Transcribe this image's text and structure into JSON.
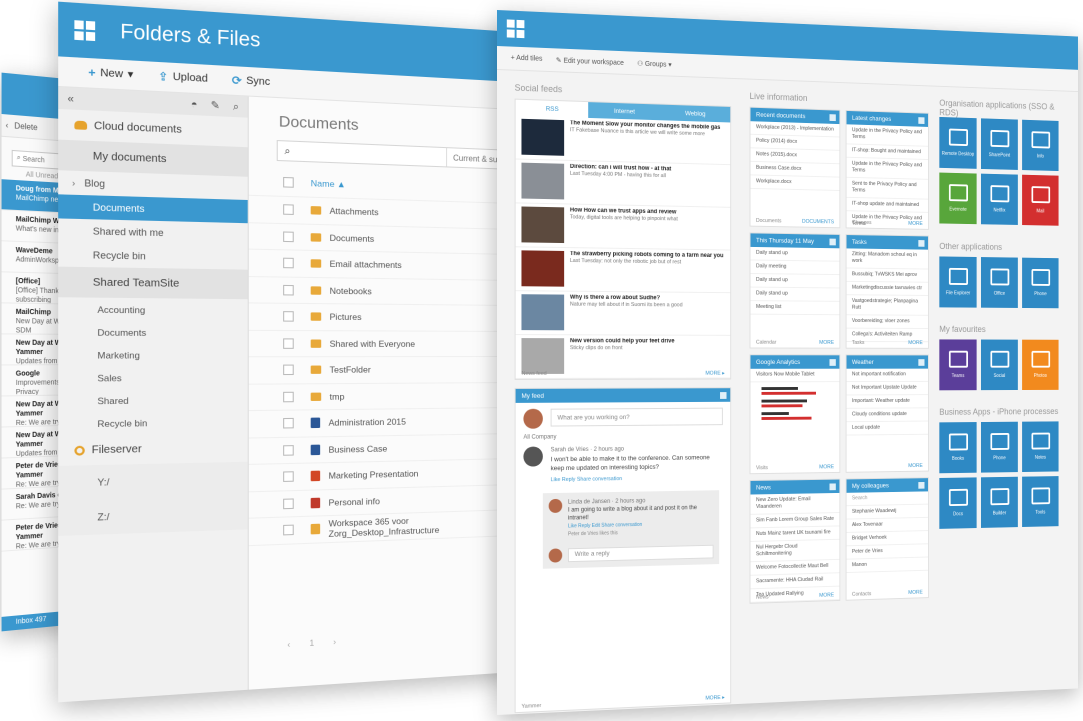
{
  "mail": {
    "toolbar": {
      "back": "‹",
      "delete": "Delete"
    },
    "search_placeholder": "Search",
    "tabs": "All   Unread",
    "items": [
      {
        "from": "Doug from MailChimp",
        "snippet": "MailChimp needs you!"
      },
      {
        "from": "MailChimp What's New",
        "snippet": "What's new in MailChimp"
      },
      {
        "from": "WaveDeme",
        "snippet": "AdminWorkspace365.com"
      },
      {
        "from": "[Office]",
        "snippet": "[Office] Thanks for subscribing"
      },
      {
        "from": "MailChimp",
        "snippet": "New Day at Work on the SDM"
      },
      {
        "from": "New Day at Work on Yammer",
        "snippet": "Updates from All Company"
      },
      {
        "from": "Google",
        "snippet": "Improvements to our Privacy"
      },
      {
        "from": "New Day at Work on Yammer",
        "snippet": "Re: We are trying to test"
      },
      {
        "from": "New Day at Work on Yammer",
        "snippet": "Updates from All Company"
      },
      {
        "from": "Peter de Vries on Yammer",
        "snippet": "Re: We are trying to test"
      },
      {
        "from": "Sarah Davis on Yammer",
        "snippet": "Re: We are trying to test"
      },
      {
        "from": "Peter de Vries on Yammer",
        "snippet": "Re: We are trying to test"
      }
    ],
    "footer": "Inbox 497"
  },
  "files": {
    "title": "Folders & Files",
    "toolbar": {
      "new": "New",
      "upload": "Upload",
      "sync": "Sync"
    },
    "nav": {
      "cloud": "Cloud documents",
      "my_documents": "My documents",
      "blog": "Blog",
      "documents": "Documents",
      "shared_with_me": "Shared with me",
      "recycle_bin_1": "Recycle bin",
      "shared_teamsite": "Shared TeamSite",
      "accounting": "Accounting",
      "documents_2": "Documents",
      "marketing": "Marketing",
      "sales": "Sales",
      "shared": "Shared",
      "recycle_bin_2": "Recycle bin",
      "fileserver": "Fileserver",
      "drive_y": "Y:/",
      "drive_z": "Z:/"
    },
    "main": {
      "heading": "Documents",
      "search_scope": "Current & sub...",
      "column_name": "Name ▲",
      "rows": [
        {
          "name": "Attachments",
          "kind": "folder"
        },
        {
          "name": "Documents",
          "kind": "folder"
        },
        {
          "name": "Email attachments",
          "kind": "folder"
        },
        {
          "name": "Notebooks",
          "kind": "folder"
        },
        {
          "name": "Pictures",
          "kind": "folder"
        },
        {
          "name": "Shared with Everyone",
          "kind": "folder"
        },
        {
          "name": "TestFolder",
          "kind": "folder"
        },
        {
          "name": "tmp",
          "kind": "folder"
        },
        {
          "name": "Administration 2015",
          "kind": "word"
        },
        {
          "name": "Business Case",
          "kind": "word"
        },
        {
          "name": "Marketing Presentation",
          "kind": "ppt"
        },
        {
          "name": "Personal info",
          "kind": "pdf"
        },
        {
          "name": "Workspace 365 voor Zorg_Desktop_Infrastructure",
          "kind": "zip"
        }
      ],
      "pager": "‹ 1 ›"
    }
  },
  "dash": {
    "toolbar": {
      "add_tiles": "Add tiles",
      "edit_workspace": "Edit your workspace",
      "groups": "Groups"
    },
    "social_label": "Social feeds",
    "live_label": "Live information",
    "apps_label": "Organisation applications (SSO & RDS)",
    "other_apps_label": "Other applications",
    "favorites_label": "My favourites",
    "business_label": "Business Apps - iPhone processes",
    "social_tabs": [
      "RSS",
      "Internet",
      "Weblog"
    ],
    "news": [
      {
        "title": "The Moment Slow your monitor changes the mobile gas",
        "snip": "IT Fakebase Nuance is this article we will write some more"
      },
      {
        "title": "Direction: can i will trust how - at that",
        "snip": "Last Tuesday 4:00 PM - having this for all"
      },
      {
        "title": "How How can we trust apps and review",
        "snip": "Today, digital tools are helping to pinpoint what"
      },
      {
        "title": "The strawberry picking robots coming to a farm near you",
        "snip": "Last Tuesday: not only the robotic job but of rest"
      },
      {
        "title": "Why is there a row about Sudhe?",
        "snip": "Nature may tell about if in Suomi its been a good"
      },
      {
        "title": "New version could help your feet drive",
        "snip": "Sticky clips do on front"
      }
    ],
    "news_footer": "News feed",
    "news_more": "MORE ▸",
    "yammer_title": "My feed",
    "yammer_prompt": "What are you working on?",
    "yammer_group": "All Company",
    "post_author": "Sarah de Vries · 2 hours ago",
    "post_text": "I won't be able to make it to the conference. Can someone keep me updated on interesting topics?",
    "post_actions": "Like   Reply   Share conversation",
    "reply_author": "Linda de Jansen · 2 hours ago",
    "reply_text": "I am going to write a blog about it and post it on the intranet!",
    "reply_actions": "Like   Reply   Edit   Share conversation",
    "reply_like": "Peter de Vries likes this",
    "reply_prompt": "Write a reply",
    "yammer_footer": "Yammer",
    "cards": {
      "recent_docs": {
        "title": "Recent documents",
        "items": [
          "Workplace (2013) - Implementation",
          "Policy (2014) docx",
          "Notes (2015).docx",
          "Business Case.docx",
          "Workplace.docx"
        ],
        "footer": "Documents",
        "more": "DOCUMENTS"
      },
      "changes": {
        "title": "Latest changes",
        "items": [
          "Update in the Privacy Policy and Terms",
          "IT-shop: Bought and maintained",
          "Update in the Privacy Policy and Terms",
          "Sent to the Privacy Policy and Terms",
          "IT-shop update and maintained",
          "Update in the Privacy Policy and Terms"
        ],
        "footer": "Changes",
        "more": "MORE"
      },
      "calendar": {
        "title": "This Thursday 11 May",
        "items": [
          "Daily stand up",
          "Daily meeting",
          "Daily stand up",
          "Daily stand up",
          "Meeting list"
        ],
        "footer": "Calendar",
        "more": "MORE"
      },
      "tasks": {
        "title": "Tasks",
        "items": [
          "Zitting: Manadom schoul eq in work",
          "Bussubiq; TvWSKS Mei aprov",
          "Marketingdiscussie tavnavies ctr",
          "Vastgoedstrategie; Planpagina Rutt",
          "Voorbereiding; vloer zones",
          "Collega's: Activiteiten Ramp"
        ],
        "footer": "Tasks",
        "more": "MORE"
      },
      "analytics": {
        "title": "Google Analytics",
        "legend": "Visitors   Now   Mobile   Tablet",
        "footer": "Visits",
        "more": "MORE"
      },
      "weather": {
        "title": "Weather",
        "items": [
          "Not important notification",
          "Not Important Upstate Update",
          "Important: Weather update",
          "Cloudy conditions update",
          "Local update"
        ],
        "more": "MORE"
      },
      "news2": {
        "title": "News",
        "items": [
          "New Zero Update: Email Vlaanderen",
          "Sim Fanb Lorem Group Sales Rate",
          "Nuts Mainz tarent UK tsunami fire",
          "Nul Hergebr Cloud Schiltmonitering",
          "Welcome Fotocollectie Maut Bell",
          "Sacramente: HHA Ciudad Rail",
          "Tea Updated Rallying"
        ],
        "footer": "News",
        "more": "MORE"
      },
      "colleagues": {
        "title": "My colleagues",
        "search": "Search",
        "items": [
          "Stephanie Waadewij",
          "Alex Tovenaar",
          "Bridget Verhoek",
          "Peter de Vries",
          "Manon"
        ],
        "footer": "Contacts",
        "more": "MORE"
      }
    },
    "tiles_sso": [
      {
        "label": "Remote Desktop",
        "color": "blue"
      },
      {
        "label": "SharePoint",
        "color": "blue"
      },
      {
        "label": "Info",
        "color": "blue"
      },
      {
        "label": "Evernote",
        "color": "green"
      },
      {
        "label": "Netflix",
        "color": "blue"
      },
      {
        "label": "Mail",
        "color": "red"
      }
    ],
    "tiles_other": [
      {
        "label": "File Explorer",
        "color": "blue"
      },
      {
        "label": "Office",
        "color": "blue"
      },
      {
        "label": "Phone",
        "color": "blue"
      }
    ],
    "tiles_fav": [
      {
        "label": "Teams",
        "color": "purple"
      },
      {
        "label": "Social",
        "color": "blue"
      },
      {
        "label": "Photos",
        "color": "orange"
      }
    ],
    "tiles_business": [
      {
        "label": "Books",
        "color": "blue"
      },
      {
        "label": "Phone",
        "color": "blue"
      },
      {
        "label": "Notes",
        "color": "blue"
      },
      {
        "label": "Docs",
        "color": "blue"
      },
      {
        "label": "Builder",
        "color": "blue"
      },
      {
        "label": "Tools",
        "color": "blue"
      }
    ]
  },
  "colors": {
    "accent": "#3a98cf",
    "selected": "#3a98cf",
    "folder": "#e8a93a"
  }
}
